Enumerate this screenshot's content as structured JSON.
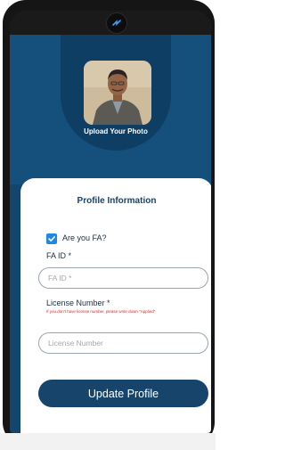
{
  "profile": {
    "upload_photo_label": "Upload Your Photo"
  },
  "form": {
    "title": "Profile Information",
    "fa_checkbox_label": "Are you FA?",
    "fa_checkbox_checked": true,
    "fa_id_label": "FA ID *",
    "fa_id_placeholder": "FA ID *",
    "license_label": "License Number *",
    "license_hint": "If you don't have license number, please write down \"Applied\"",
    "license_placeholder": "License Number",
    "submit_label": "Update Profile"
  },
  "colors": {
    "primary": "#17446b",
    "header": "#15507d",
    "checkbox": "#1e88e5",
    "hint": "#d12b2b"
  }
}
